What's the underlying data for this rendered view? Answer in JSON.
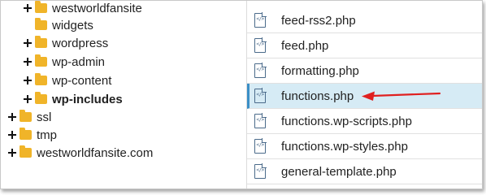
{
  "tree": {
    "items": [
      {
        "label": "westworldfansite",
        "expandable": true,
        "bold": false
      },
      {
        "label": "widgets",
        "expandable": false,
        "bold": false
      },
      {
        "label": "wordpress",
        "expandable": true,
        "bold": false
      },
      {
        "label": "wp-admin",
        "expandable": true,
        "bold": false
      },
      {
        "label": "wp-content",
        "expandable": true,
        "bold": false
      },
      {
        "label": "wp-includes",
        "expandable": true,
        "bold": true
      },
      {
        "label": "ssl",
        "expandable": true,
        "bold": false
      },
      {
        "label": "tmp",
        "expandable": true,
        "bold": false
      },
      {
        "label": "westworldfansite.com",
        "expandable": true,
        "bold": false
      }
    ]
  },
  "files": {
    "items": [
      {
        "name": "feed-rss2.php"
      },
      {
        "name": "feed.php"
      },
      {
        "name": "formatting.php"
      },
      {
        "name": "functions.php",
        "selected": true
      },
      {
        "name": "functions.wp-scripts.php"
      },
      {
        "name": "functions.wp-styles.php"
      },
      {
        "name": "general-template.php"
      }
    ]
  },
  "colors": {
    "folder": "#f0b429",
    "selected_row": "#d6ebf5",
    "annotation_arrow": "#e02020"
  },
  "icons": {
    "folder": "folder-icon",
    "file": "php-file-icon",
    "expand": "plus-icon",
    "annotation": "red-arrow-annotation"
  }
}
